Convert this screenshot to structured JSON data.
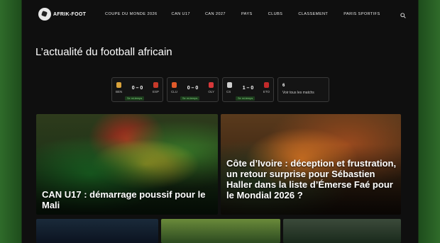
{
  "brand": {
    "logo_text": "AFRIK-FOOT"
  },
  "nav": {
    "items": [
      "COUPE DU MONDE 2026",
      "CAN U17",
      "CAN 2027",
      "PAYS",
      "CLUBS",
      "CLASSEMENT",
      "PARIS SPORTIFS"
    ]
  },
  "headline": "L’actualité du football africain",
  "scores": [
    {
      "home": "BEN",
      "away": "ESP",
      "score": "0 – 0",
      "status": "Se mi-temps"
    },
    {
      "home": "CLU",
      "away": "OLY",
      "score": "0 – 0",
      "status": "Se mi-temps"
    },
    {
      "home": "CS",
      "away": "ETO",
      "score": "1 – 0",
      "status": "Se mi-temps"
    }
  ],
  "more_matches": {
    "count": "6",
    "label": "Voir tous les matchs"
  },
  "articles": [
    {
      "title": "CAN U17 : démarrage poussif pour le Mali"
    },
    {
      "title": "Côte d’Ivoire : déception et frustration, un retour surprise pour Sébastien Haller dans la liste d’Émerse Faé pour le Mondial 2026 ?"
    }
  ],
  "colors": {
    "accent": "#7ed57e",
    "page_bg": "#0f0f0f",
    "side_bg": "#2f6b2a"
  },
  "icons": {
    "search": "search-icon"
  }
}
